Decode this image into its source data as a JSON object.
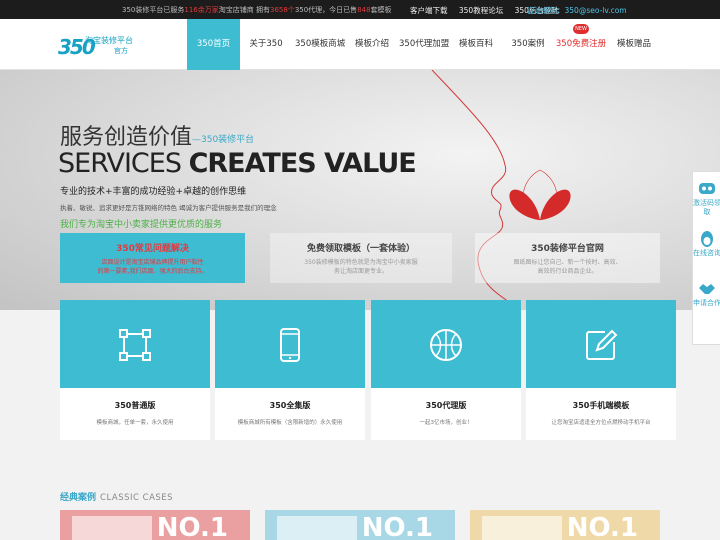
{
  "topbar": {
    "notice_a": "350装修平台已服务",
    "notice_b": "116余万家",
    "notice_c": "淘宝店铺商 拥有",
    "notice_d": "3658个",
    "notice_e": "350代理，今日已售",
    "notice_f": "848",
    "notice_g": "套模板",
    "links": [
      "客户端下载",
      "350教程论坛",
      "350后台登陆"
    ],
    "contact_email": "咨询邮箱：350@seo-lv.com"
  },
  "logo": {
    "mark": "350",
    "line1": "淘宝装修平台",
    "line2": "官方"
  },
  "nav": {
    "items": [
      {
        "label": "350首页"
      },
      {
        "label": "关于350"
      },
      {
        "label": "350模板商城"
      },
      {
        "label": "模板介绍"
      },
      {
        "label": "350代理加盟"
      },
      {
        "label": "模板百科"
      },
      {
        "label": "350案例"
      },
      {
        "label": "350免费注册"
      },
      {
        "label": "模板赠品"
      }
    ],
    "new_badge": "NEW"
  },
  "banner": {
    "title_cn": "服务创造价值",
    "title_cn_tag": "—350装修平台",
    "title_en_light": "SERVICES",
    "title_en_bold": "CREATES VALUE",
    "line1": "专业的技术+丰富的成功经验+卓越的创作思维",
    "line2": "执着、敏锐、追求更好是方锥网络的特色  竭诚为客户提供服务是我们的理念",
    "line3": "我们专为淘宝中小卖家提供更优质的服务",
    "boxes": [
      {
        "title": "350常见问题解决",
        "desc1": "店面设计是淘宝店铺品牌提升用户黏性",
        "desc2": "的第一要素,我们店面、强大的后台支持。"
      },
      {
        "title": "免费领取模板（一套体验）",
        "desc1": "350装修模板的特色就是为淘宝中小卖家服",
        "desc2": "务让淘店面更专业。"
      },
      {
        "title": "350装修平台官网",
        "desc1": "图纸图标让您自己、新一个按时、高效、",
        "desc2": "高效的行业商品企业。"
      }
    ]
  },
  "products": [
    {
      "name": "350普通版",
      "desc": "模板商城，任单一套，永久使用",
      "icon": "crop-frame-icon"
    },
    {
      "name": "350全集版",
      "desc": "模板商城所有模板（含限新增的）永久使用",
      "icon": "mobile-phone-icon"
    },
    {
      "name": "350代理版",
      "desc": "一起3亿市场，创业！",
      "icon": "basketball-icon"
    },
    {
      "name": "350手机端模板",
      "desc": "让您淘宝店适逢全方位点燃移动手机平台",
      "icon": "edit-icon"
    }
  ],
  "cases": {
    "title_cn": "经典案例",
    "title_en": "CLASSIC CASES",
    "items": [
      {
        "rank": "NO.1"
      },
      {
        "rank": "NO.1"
      },
      {
        "rank": "NO.1"
      }
    ]
  },
  "side": {
    "items": [
      "激活码领取",
      "在线咨询",
      "申请合作"
    ]
  },
  "colors": {
    "accent": "#3dbcd2",
    "red": "#e02e2e",
    "green": "#4bb046"
  }
}
